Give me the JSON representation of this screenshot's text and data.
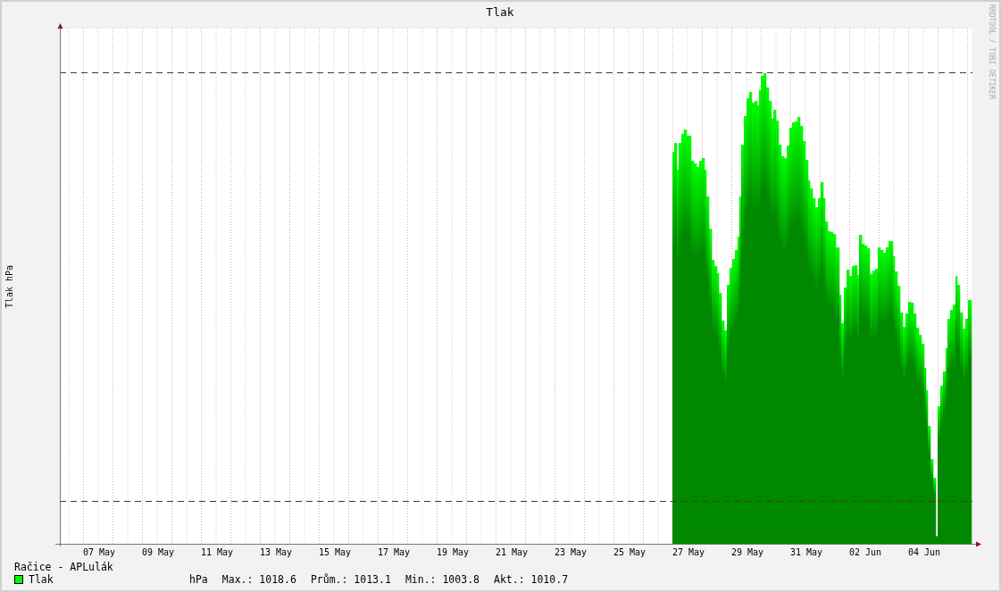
{
  "title": "Tlak",
  "y_axis_label": "Tlak hPa",
  "credit": "RRDTOOL / TOBI OETIKER",
  "x_labels": [
    "07 May",
    "09 May",
    "11 May",
    "13 May",
    "15 May",
    "17 May",
    "19 May",
    "21 May",
    "23 May",
    "25 May",
    "27 May",
    "29 May",
    "31 May",
    "02 Jun",
    "04 Jun"
  ],
  "legend": {
    "source": "Račice - APLulák",
    "series": [
      {
        "name": "Tlak",
        "color": "#00ff00",
        "unit": "hPa",
        "stats": [
          "Max.: 1018.6",
          "Prům.: 1013.1",
          "Min.: 1003.8",
          "Akt.: 1010.7"
        ]
      }
    ]
  }
}
